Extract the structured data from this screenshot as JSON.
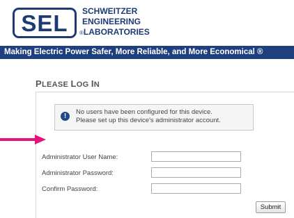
{
  "header": {
    "logo_text": "SEL",
    "company_line1": "SCHWEITZER",
    "company_line2": "ENGINEERING",
    "company_line3_prefix": "®",
    "company_line3": "LABORATORIES",
    "tagline": "Making Electric Power Safer, More Reliable, and More Economical ®"
  },
  "login": {
    "title_first_p": "P",
    "title_lease": "LEASE ",
    "title_first_l": "L",
    "title_og": "OG ",
    "title_first_i": "I",
    "title_n": "N",
    "notice_line1": "No users have been configured for this device.",
    "notice_line2": "Please set up this device's administrator account.",
    "fields": [
      {
        "label": "Administrator User Name:",
        "value": ""
      },
      {
        "label": "Administrator Password:",
        "value": ""
      },
      {
        "label": "Confirm Password:",
        "value": ""
      }
    ],
    "submit_label": "Submit"
  },
  "colors": {
    "brand_navy": "#1d3b73",
    "banner_bg": "#1f3f7f",
    "arrow_magenta": "#e4127d"
  },
  "icons": {
    "notice": "info-icon",
    "pointer": "arrow-right-icon"
  }
}
